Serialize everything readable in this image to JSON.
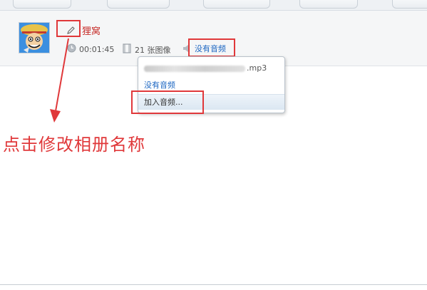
{
  "album": {
    "name": "狸窝",
    "duration": "00:01:45",
    "photo_count": "21 张图像",
    "audio_status": "没有音频"
  },
  "audio_menu": {
    "track_visible": ".mp3",
    "none_option": "没有音频",
    "add_option": "加入音频..."
  },
  "annotation": {
    "text": "点击修改相册名称",
    "color": "#e0383a"
  },
  "icons": {
    "edit": "pencil-icon",
    "duration": "clock-icon",
    "photos": "film-icon",
    "audio": "speaker-icon"
  },
  "colors": {
    "link": "#1c66c2",
    "album_name": "#c7302c",
    "highlight": "#e0383a"
  }
}
